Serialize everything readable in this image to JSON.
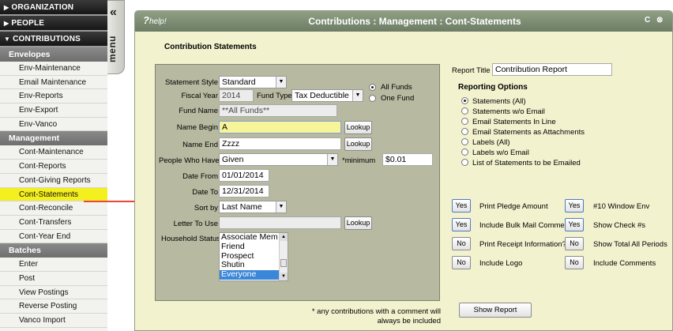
{
  "sidebar": {
    "organization": "ORGANIZATION",
    "people": "PEOPLE",
    "contributions": "CONTRIBUTIONS",
    "envelopes_header": "Envelopes",
    "envelopes": [
      "Env-Maintenance",
      "Email Maintenance",
      "Env-Reports",
      "Env-Export",
      "Env-Vanco"
    ],
    "management_header": "Management",
    "management": [
      "Cont-Maintenance",
      "Cont-Reports",
      "Cont-Giving Reports",
      "Cont-Statements",
      "Cont-Reconcile",
      "Cont-Transfers",
      "Cont-Year End"
    ],
    "batches_header": "Batches",
    "batches": [
      "Enter",
      "Post",
      "View Postings",
      "Reverse Posting",
      "Vanco Import"
    ]
  },
  "menu_tab": {
    "chevron": "«",
    "label": "menu"
  },
  "titlebar": {
    "help_q": "?",
    "help_text": "help!",
    "title": "Contributions : Management : Cont-Statements",
    "refresh": "C",
    "close": "⊗"
  },
  "section_title": "Contribution Statements",
  "form": {
    "statement_style_label": "Statement Style",
    "statement_style": "Standard",
    "fiscal_year_label": "Fiscal Year",
    "fiscal_year": "2014",
    "fund_type_label": "Fund Type",
    "fund_type": "Tax Deductible",
    "all_funds": "All Funds",
    "one_fund": "One Fund",
    "fund_name_label": "Fund Name",
    "fund_name": "**All Funds**",
    "name_begin_label": "Name Begin",
    "name_begin": "A",
    "name_end_label": "Name End",
    "name_end": "Zzzz",
    "lookup": "Lookup",
    "people_who_have_label": "People Who Have",
    "people_who_have": "Given",
    "minimum_label": "*minimum",
    "minimum": "$0.01",
    "date_from_label": "Date From",
    "date_from": "01/01/2014",
    "date_to_label": "Date To",
    "date_to": "12/31/2014",
    "sort_by_label": "Sort by",
    "sort_by": "Last Name",
    "letter_to_use_label": "Letter To Use",
    "household_status_label": "Household Status",
    "household_status_options": [
      "Associate Mem",
      "Friend",
      "Prospect",
      "Shutin",
      "Everyone"
    ]
  },
  "note_line1": "* any contributions with a comment will",
  "note_line2": "always be included",
  "report_title_label": "Report Title",
  "report_title": "Contribution Report",
  "reporting_options_header": "Reporting Options",
  "reporting_options": [
    "Statements (All)",
    "Statements w/o Email",
    "Email Statements In Line",
    "Email Statements as Attachments",
    "Labels (All)",
    "Labels w/o Email",
    "List of Statements to be Emailed"
  ],
  "toggles": [
    {
      "value": "Yes",
      "label": "Print Pledge Amount"
    },
    {
      "value": "Yes",
      "label": "#10 Window Env"
    },
    {
      "value": "Yes",
      "label": "Include Bulk Mail Comment"
    },
    {
      "value": "Yes",
      "label": "Show Check #s"
    },
    {
      "value": "No",
      "label": "Print Receipt Information?"
    },
    {
      "value": "No",
      "label": "Show Total All Periods"
    },
    {
      "value": "No",
      "label": "Include Logo"
    },
    {
      "value": "No",
      "label": "Include Comments"
    }
  ],
  "show_report": "Show Report",
  "colors": {
    "title_bar": "#7d8d74",
    "panel_bg": "#f2f2cf",
    "form_bg": "#b7b9a0",
    "highlight": "#f4ef1e",
    "arrow": "#e8473c"
  }
}
